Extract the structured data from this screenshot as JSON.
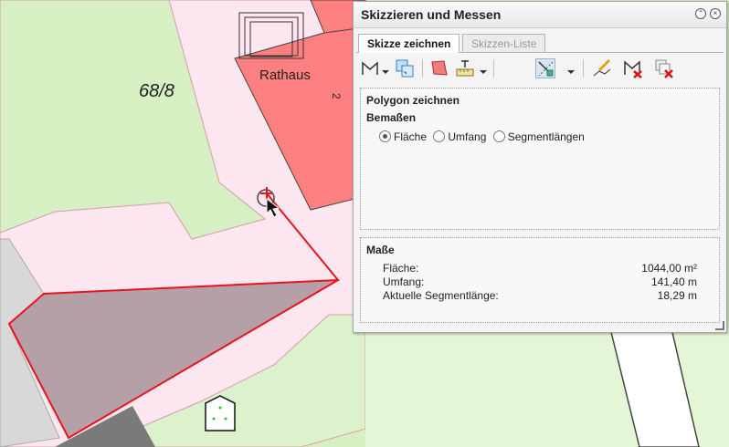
{
  "map": {
    "parcel_label": "68/8",
    "building_label": "Rathaus",
    "house_number": "2"
  },
  "panel": {
    "title": "Skizzieren und Messen",
    "tabs": [
      {
        "label": "Skizze zeichnen",
        "active": true
      },
      {
        "label": "Skizzen-Liste",
        "active": false
      }
    ],
    "toolbar_icons": [
      "draw-line-icon",
      "edit-sketch-icon",
      "draw-polygon-icon",
      "measure-ruler-icon",
      "snap-icon",
      "edit-pen-icon",
      "delete-sketch-icon",
      "delete-all-icon"
    ],
    "draw_section": {
      "title": "Polygon zeichnen",
      "subtitle": "Bemaßen",
      "options": [
        {
          "label": "Fläche",
          "checked": true
        },
        {
          "label": "Umfang",
          "checked": false
        },
        {
          "label": "Segmentlängen",
          "checked": false
        }
      ]
    },
    "measurements": {
      "title": "Maße",
      "rows": [
        {
          "label": "Fläche:",
          "value": "1044,00 m²"
        },
        {
          "label": "Umfang:",
          "value": "141,40 m"
        },
        {
          "label": "Aktuelle Segmentlänge:",
          "value": "18,29 m"
        }
      ]
    }
  },
  "colors": {
    "parcel_fill": "#fce6f0",
    "green_area": "#d6f0c4",
    "building": "#ff8080",
    "sketch_line": "#e8141c",
    "sketch_fill": "#b5a0a8"
  }
}
